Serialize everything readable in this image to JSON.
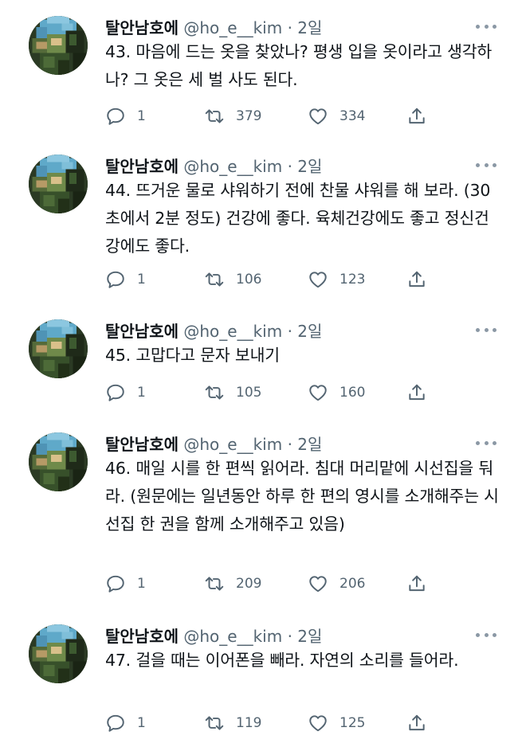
{
  "tweets": [
    {
      "name": "탈안남호에",
      "handle": "@ho_e__kim",
      "sep": "·",
      "time": "2일",
      "text": "43. 마음에 드는 옷을 찾았나? 평생 입을 옷이라고 생각하나? 그 옷은 세 벌 사도 된다.",
      "replies": "1",
      "retweets": "379",
      "likes": "334"
    },
    {
      "name": "탈안남호에",
      "handle": "@ho_e__kim",
      "sep": "·",
      "time": "2일",
      "text": "44. 뜨거운 물로 샤워하기 전에 찬물 샤워를 해 보라. (30초에서 2분 정도) 건강에 좋다. 육체건강에도 좋고 정신건강에도 좋다.",
      "replies": "1",
      "retweets": "106",
      "likes": "123"
    },
    {
      "name": "탈안남호에",
      "handle": "@ho_e__kim",
      "sep": "·",
      "time": "2일",
      "text": "45. 고맙다고 문자 보내기",
      "replies": "1",
      "retweets": "105",
      "likes": "160"
    },
    {
      "name": "탈안남호에",
      "handle": "@ho_e__kim",
      "sep": "·",
      "time": "2일",
      "text": "46. 매일 시를 한 편씩 읽어라. 침대 머리맡에 시선집을 둬라. (원문에는 일년동안 하루 한 편의 영시를 소개해주는 시선집 한 권을 함께 소개해주고 있음)",
      "replies": "1",
      "retweets": "209",
      "likes": "206"
    },
    {
      "name": "탈안남호에",
      "handle": "@ho_e__kim",
      "sep": "·",
      "time": "2일",
      "text": "47. 걸을 때는 이어폰을 빼라. 자연의 소리를 들어라.",
      "replies": "1",
      "retweets": "119",
      "likes": "125"
    }
  ],
  "icons": {
    "reply": "reply-icon",
    "retweet": "retweet-icon",
    "like": "like-icon",
    "share": "share-icon",
    "more": "more-icon",
    "avatar": "avatar"
  },
  "colors": {
    "text": "#0f1419",
    "secondary": "#536471",
    "background": "#ffffff"
  }
}
